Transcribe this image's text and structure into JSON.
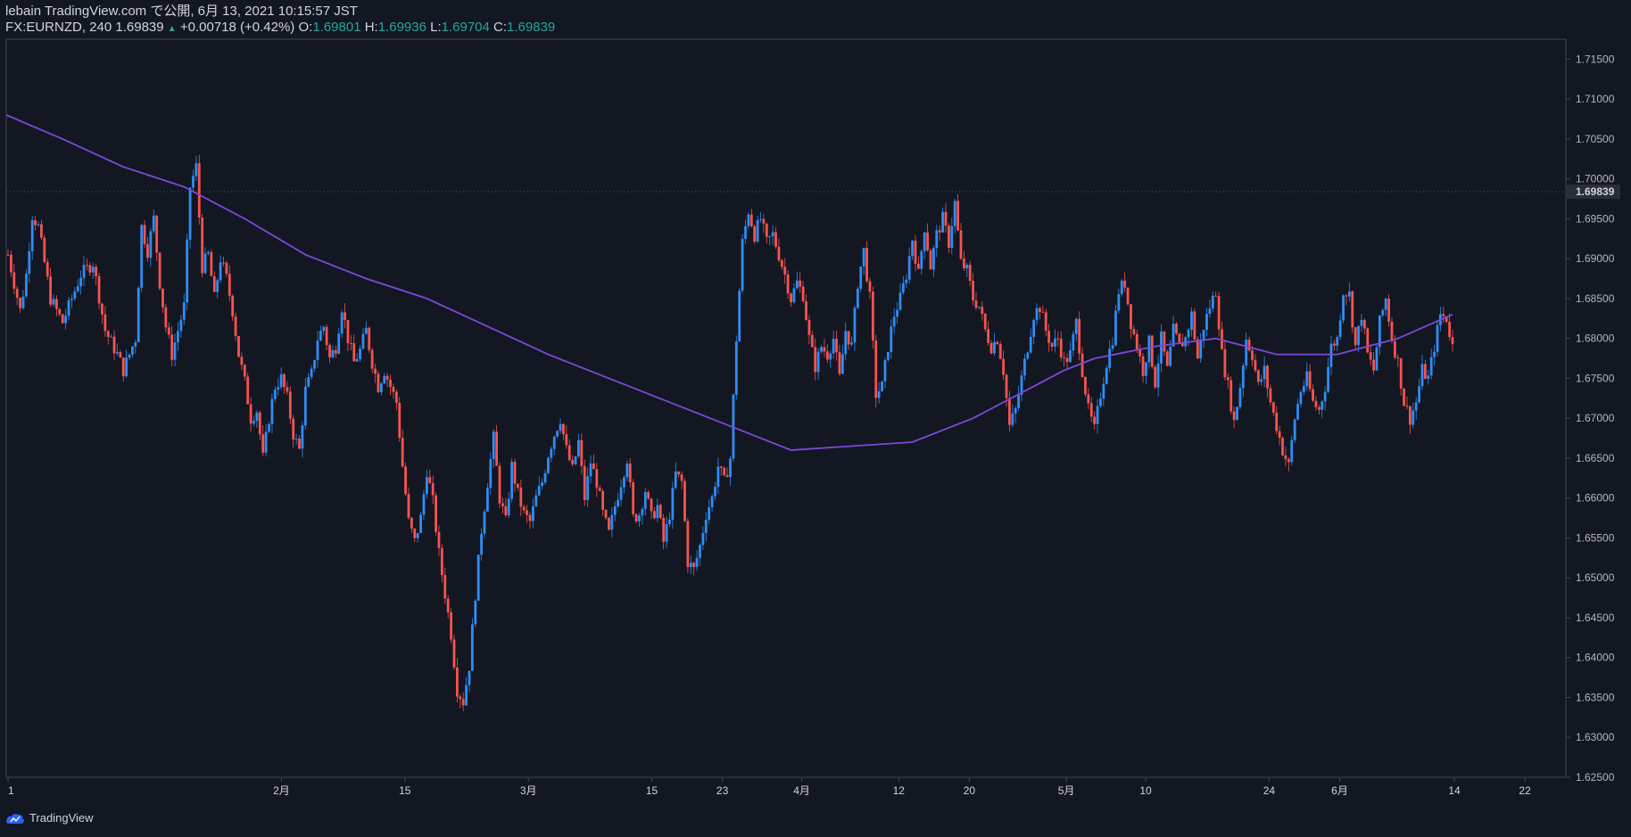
{
  "header": {
    "published": "lebain TradingView.com で公開, 6月 13, 2021 10:15:57 JST",
    "symbol": "FX:EURNZD, 240",
    "last": "1.69839",
    "arrow": "▲",
    "change": "+0.00718 (+0.42%)",
    "o_label": "O:",
    "o_value": "1.69801",
    "h_label": "H:",
    "h_value": "1.69936",
    "l_label": "L:",
    "l_value": "1.69704",
    "c_label": "C:",
    "c_value": "1.69839"
  },
  "footer": {
    "brand": "TradingView"
  },
  "colors": {
    "background": "#131722",
    "up": "#2f8df4",
    "down": "#f6544f",
    "ma": "#7e48d8",
    "axis": "#b2b5be"
  },
  "chart_data": {
    "type": "candlestick",
    "symbol": "FX:EURNZD",
    "timeframe": "240",
    "ylim": [
      1.625,
      1.7175
    ],
    "y_ticks": [
      "1.71500",
      "1.71000",
      "1.70500",
      "1.70000",
      "1.69500",
      "1.69000",
      "1.68500",
      "1.68000",
      "1.67500",
      "1.67000",
      "1.66500",
      "1.66000",
      "1.65500",
      "1.65000",
      "1.64500",
      "1.64000",
      "1.63500",
      "1.63000",
      "1.62500"
    ],
    "last_price_label": "1.69839",
    "x_ticks": [
      {
        "label": "1",
        "day": 1
      },
      {
        "label": "2月",
        "day": 32
      },
      {
        "label": "15",
        "day": 46
      },
      {
        "label": "3月",
        "day": 60
      },
      {
        "label": "15",
        "day": 74
      },
      {
        "label": "23",
        "day": 82
      },
      {
        "label": "4月",
        "day": 91
      },
      {
        "label": "12",
        "day": 102
      },
      {
        "label": "20",
        "day": 110
      },
      {
        "label": "5月",
        "day": 121
      },
      {
        "label": "10",
        "day": 130
      },
      {
        "label": "24",
        "day": 144
      },
      {
        "label": "6月",
        "day": 152
      },
      {
        "label": "14",
        "day": 165
      },
      {
        "label": "22",
        "day": 173
      }
    ],
    "price_path": [
      [
        1,
        1.6905
      ],
      [
        3,
        1.6835
      ],
      [
        4,
        1.688
      ],
      [
        5,
        1.6955
      ],
      [
        6,
        1.694
      ],
      [
        8,
        1.685
      ],
      [
        10,
        1.682
      ],
      [
        12,
        1.686
      ],
      [
        13,
        1.688
      ],
      [
        15,
        1.6895
      ],
      [
        17,
        1.681
      ],
      [
        19,
        1.678
      ],
      [
        20,
        1.676
      ],
      [
        22,
        1.68
      ],
      [
        23,
        1.694
      ],
      [
        24,
        1.691
      ],
      [
        25,
        1.695
      ],
      [
        26,
        1.687
      ],
      [
        27,
        1.6815
      ],
      [
        28,
        1.678
      ],
      [
        30,
        1.684
      ],
      [
        31,
        1.699
      ],
      [
        32,
        1.7015
      ],
      [
        33,
        1.689
      ],
      [
        34,
        1.6905
      ],
      [
        35,
        1.685
      ],
      [
        36,
        1.69
      ],
      [
        37,
        1.6875
      ],
      [
        38,
        1.6835
      ],
      [
        39,
        1.678
      ],
      [
        40,
        1.6745
      ],
      [
        41,
        1.67
      ],
      [
        42,
        1.671
      ],
      [
        43,
        1.665
      ],
      [
        44,
        1.67
      ],
      [
        45,
        1.674
      ],
      [
        46,
        1.675
      ],
      [
        47,
        1.6725
      ],
      [
        48,
        1.668
      ],
      [
        49,
        1.666
      ],
      [
        50,
        1.6735
      ],
      [
        51,
        1.6755
      ],
      [
        52,
        1.68
      ],
      [
        53,
        1.6815
      ],
      [
        54,
        1.6775
      ],
      [
        55,
        1.679
      ],
      [
        56,
        1.684
      ],
      [
        57,
        1.68
      ],
      [
        58,
        1.677
      ],
      [
        59,
        1.6785
      ],
      [
        60,
        1.681
      ],
      [
        61,
        1.677
      ],
      [
        62,
        1.674
      ],
      [
        63,
        1.676
      ],
      [
        64,
        1.674
      ],
      [
        65,
        1.672
      ],
      [
        66,
        1.664
      ],
      [
        67,
        1.657
      ],
      [
        68,
        1.6545
      ],
      [
        69,
        1.6575
      ],
      [
        70,
        1.6635
      ],
      [
        71,
        1.6595
      ],
      [
        72,
        1.653
      ],
      [
        73,
        1.648
      ],
      [
        74,
        1.643
      ],
      [
        75,
        1.636
      ],
      [
        76,
        1.6345
      ],
      [
        77,
        1.639
      ],
      [
        78,
        1.648
      ],
      [
        79,
        1.656
      ],
      [
        80,
        1.662
      ],
      [
        81,
        1.6675
      ],
      [
        82,
        1.66
      ],
      [
        83,
        1.657
      ],
      [
        84,
        1.664
      ],
      [
        85,
        1.6605
      ],
      [
        86,
        1.658
      ],
      [
        87,
        1.657
      ],
      [
        88,
        1.66
      ],
      [
        89,
        1.662
      ],
      [
        90,
        1.6655
      ],
      [
        91,
        1.668
      ],
      [
        92,
        1.67
      ],
      [
        93,
        1.666
      ],
      [
        94,
        1.6635
      ],
      [
        95,
        1.667
      ],
      [
        96,
        1.66
      ],
      [
        97,
        1.6645
      ],
      [
        98,
        1.662
      ],
      [
        99,
        1.658
      ],
      [
        100,
        1.6555
      ],
      [
        101,
        1.659
      ],
      [
        102,
        1.662
      ],
      [
        103,
        1.665
      ],
      [
        104,
        1.6575
      ],
      [
        105,
        1.658
      ],
      [
        106,
        1.661
      ],
      [
        107,
        1.6575
      ],
      [
        108,
        1.659
      ],
      [
        109,
        1.6545
      ],
      [
        110,
        1.658
      ],
      [
        111,
        1.663
      ],
      [
        112,
        1.662
      ],
      [
        113,
        1.652
      ],
      [
        114,
        1.651
      ],
      [
        115,
        1.654
      ],
      [
        116,
        1.658
      ],
      [
        117,
        1.66
      ],
      [
        118,
        1.664
      ],
      [
        119,
        1.662
      ],
      [
        120,
        1.665
      ],
      [
        121,
        1.68
      ],
      [
        122,
        1.692
      ],
      [
        123,
        1.696
      ],
      [
        124,
        1.693
      ],
      [
        125,
        1.695
      ],
      [
        126,
        1.692
      ],
      [
        127,
        1.693
      ],
      [
        128,
        1.6905
      ],
      [
        129,
        1.688
      ],
      [
        130,
        1.685
      ],
      [
        131,
        1.687
      ],
      [
        132,
        1.6855
      ],
      [
        133,
        1.68
      ],
      [
        134,
        1.6765
      ],
      [
        135,
        1.679
      ],
      [
        136,
        1.678
      ],
      [
        137,
        1.68
      ],
      [
        138,
        1.675
      ],
      [
        139,
        1.681
      ],
      [
        140,
        1.679
      ],
      [
        141,
        1.687
      ],
      [
        142,
        1.691
      ],
      [
        143,
        1.685
      ],
      [
        144,
        1.673
      ],
      [
        145,
        1.674
      ],
      [
        146,
        1.679
      ],
      [
        147,
        1.683
      ],
      [
        148,
        1.685
      ],
      [
        149,
        1.688
      ],
      [
        150,
        1.6925
      ],
      [
        151,
        1.688
      ],
      [
        152,
        1.694
      ],
      [
        153,
        1.689
      ],
      [
        154,
        1.693
      ],
      [
        155,
        1.695
      ],
      [
        156,
        1.692
      ],
      [
        157,
        1.697
      ],
      [
        158,
        1.6895
      ],
      [
        159,
        1.6885
      ],
      [
        160,
        1.685
      ],
      [
        161,
        1.684
      ],
      [
        162,
        1.681
      ],
      [
        163,
        1.679
      ],
      [
        164,
        1.68
      ],
      [
        165,
        1.676
      ],
      [
        166,
        1.669
      ],
      [
        167,
        1.671
      ],
      [
        168,
        1.675
      ],
      [
        169,
        1.679
      ],
      [
        170,
        1.683
      ],
      [
        171,
        1.684
      ],
      [
        172,
        1.681
      ],
      [
        173,
        1.679
      ],
      [
        174,
        1.68
      ],
      [
        175,
        1.677
      ],
      [
        176,
        1.678
      ],
      [
        177,
        1.682
      ],
      [
        178,
        1.676
      ],
      [
        179,
        1.671
      ],
      [
        180,
        1.6685
      ],
      [
        181,
        1.673
      ],
      [
        182,
        1.677
      ],
      [
        183,
        1.68
      ],
      [
        184,
        1.686
      ],
      [
        185,
        1.687
      ],
      [
        186,
        1.682
      ],
      [
        187,
        1.679
      ],
      [
        188,
        1.676
      ],
      [
        189,
        1.6795
      ],
      [
        190,
        1.6745
      ],
      [
        191,
        1.68
      ],
      [
        192,
        1.676
      ],
      [
        193,
        1.681
      ],
      [
        194,
        1.679
      ],
      [
        195,
        1.68
      ],
      [
        196,
        1.683
      ],
      [
        197,
        1.6775
      ],
      [
        198,
        1.6815
      ],
      [
        199,
        1.684
      ],
      [
        200,
        1.686
      ],
      [
        201,
        1.678
      ],
      [
        202,
        1.674
      ],
      [
        203,
        1.6695
      ],
      [
        204,
        1.674
      ],
      [
        205,
        1.68
      ],
      [
        206,
        1.678
      ],
      [
        207,
        1.674
      ],
      [
        208,
        1.676
      ],
      [
        209,
        1.672
      ],
      [
        210,
        1.669
      ],
      [
        211,
        1.666
      ],
      [
        212,
        1.664
      ],
      [
        213,
        1.67
      ],
      [
        214,
        1.6735
      ],
      [
        215,
        1.675
      ],
      [
        216,
        1.672
      ],
      [
        217,
        1.671
      ],
      [
        218,
        1.674
      ],
      [
        219,
        1.679
      ],
      [
        220,
        1.68
      ],
      [
        221,
        1.686
      ],
      [
        222,
        1.6855
      ],
      [
        223,
        1.679
      ],
      [
        224,
        1.683
      ],
      [
        225,
        1.678
      ],
      [
        226,
        1.676
      ],
      [
        227,
        1.682
      ],
      [
        228,
        1.685
      ],
      [
        229,
        1.68
      ],
      [
        230,
        1.677
      ],
      [
        231,
        1.672
      ],
      [
        232,
        1.67
      ],
      [
        233,
        1.672
      ],
      [
        234,
        1.676
      ],
      [
        235,
        1.675
      ],
      [
        236,
        1.679
      ],
      [
        237,
        1.683
      ],
      [
        238,
        1.6825
      ],
      [
        239,
        1.679
      ]
    ],
    "ma_path": [
      [
        0,
        1.708
      ],
      [
        10,
        1.705
      ],
      [
        20,
        1.7015
      ],
      [
        30,
        1.699
      ],
      [
        40,
        1.695
      ],
      [
        50,
        1.6905
      ],
      [
        60,
        1.6875
      ],
      [
        70,
        1.685
      ],
      [
        80,
        1.6815
      ],
      [
        90,
        1.678
      ],
      [
        100,
        1.675
      ],
      [
        110,
        1.672
      ],
      [
        120,
        1.669
      ],
      [
        130,
        1.666
      ],
      [
        140,
        1.6665
      ],
      [
        150,
        1.667
      ],
      [
        160,
        1.67
      ],
      [
        170,
        1.674
      ],
      [
        175,
        1.676
      ],
      [
        180,
        1.6775
      ],
      [
        190,
        1.679
      ],
      [
        200,
        1.68
      ],
      [
        210,
        1.678
      ],
      [
        220,
        1.678
      ],
      [
        230,
        1.68
      ],
      [
        239,
        1.683
      ]
    ]
  }
}
